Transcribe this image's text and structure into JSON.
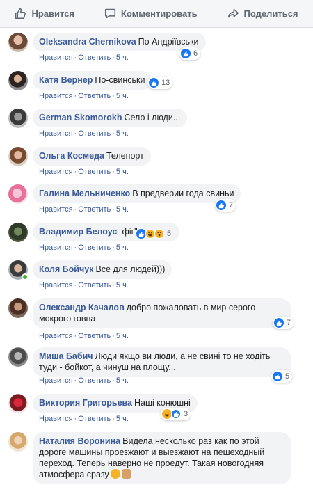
{
  "action_bar": {
    "like": "Нравится",
    "comment": "Комментировать",
    "share": "Поделиться"
  },
  "meta_labels": {
    "like": "Нравится",
    "reply": "Ответить",
    "dot": "·"
  },
  "comments": [
    {
      "author": "Oleksandra Chernikova",
      "text": "По Андріївськи",
      "time": "5 ч.",
      "reactions": "6"
    },
    {
      "author": "Катя Вернер",
      "text": "По-свинськи",
      "time": "5 ч.",
      "reactions": "13"
    },
    {
      "author": "German Skomorokh",
      "text": "Село і люди...",
      "time": "5 ч.",
      "reactions": ""
    },
    {
      "author": "Ольга Космеда",
      "text": "Телепорт",
      "time": "5 ч.",
      "reactions": ""
    },
    {
      "author": "Галина Мельниченко",
      "text": "В предверии года свиньи",
      "time": "5 ч.",
      "reactions": "7"
    },
    {
      "author": "Владимир Белоус",
      "text": "-фiг\"",
      "time": "5 ч.",
      "reactions": "5"
    },
    {
      "author": "Коля Бойчук",
      "text": "Все для людей)))",
      "time": "5 ч.",
      "reactions": ""
    },
    {
      "author": "Олександр Качалов",
      "text": "добро пожаловать в мир серого мокрого говна",
      "time": "5 ч.",
      "reactions": "7"
    },
    {
      "author": "Миша Бабич",
      "text": "Люди якщо ви люди, а не свині то не ходіть туди - бойкот, а чинуш на площу...",
      "time": "5 ч.",
      "reactions": "5"
    },
    {
      "author": "Виктория Григорьева",
      "text": "Наші конюшні",
      "time": "5 ч.",
      "reactions": "3"
    },
    {
      "author": "Наталия Воронина",
      "text": "Видела несколько раз как по этой дороге машины проезжают и выезжают на пешеходный переход. Теперь наверно не проедут. Такая новогодняя атмосфера сразу",
      "time": "",
      "reactions": ""
    }
  ],
  "colors": {
    "link": "#385898",
    "bubble": "#f2f3f5",
    "like_blue": "#1877f2",
    "online": "#42b72a"
  }
}
